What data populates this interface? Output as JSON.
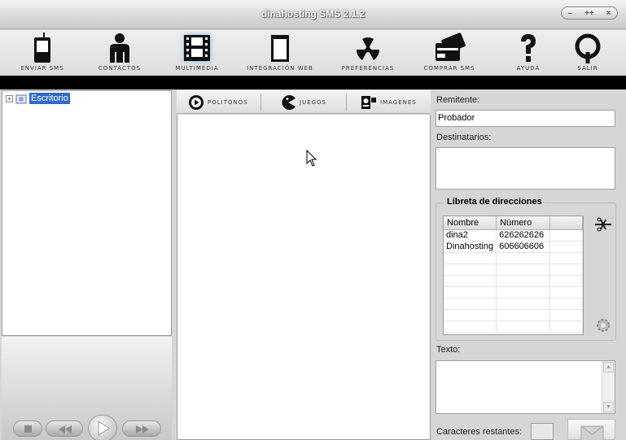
{
  "window": {
    "title": "dinahosting SMS 2.1.2",
    "buttons": [
      "–",
      "++",
      "×"
    ]
  },
  "toolbar": {
    "items": [
      {
        "label": "ENVIAR SMS",
        "icon": "phone-icon"
      },
      {
        "label": "CONTACTOS",
        "icon": "person-icon"
      },
      {
        "label": "MULTIMEDIA",
        "icon": "film-icon"
      },
      {
        "label": "INTEGRACIÓN WEB",
        "icon": "browser-window-icon"
      },
      {
        "label": "PREFERENCIAS",
        "icon": "radiation-icon"
      },
      {
        "label": "COMPRAR SMS",
        "icon": "credit-card-icon"
      },
      {
        "label": "AYUDA",
        "icon": "question-icon"
      },
      {
        "label": "SALIR",
        "icon": "power-icon"
      }
    ]
  },
  "tree": {
    "root_label": "Escritorio",
    "expander": "+"
  },
  "tabs": [
    {
      "label": "POLITONOS",
      "icon": "play-circle-icon"
    },
    {
      "label": "JUEGOS",
      "icon": "pacman-icon"
    },
    {
      "label": "IMAGENES",
      "icon": "camera-icon"
    }
  ],
  "form": {
    "sender_label": "Remitente:",
    "sender_value": "Probador",
    "recipients_label": "Destinatarios:",
    "addressbook_title": "Libreta de direcciones",
    "addressbook_columns": [
      "Nombre",
      "Número"
    ],
    "addressbook_rows": [
      {
        "name": "dina2",
        "number": "626262626"
      },
      {
        "name": "Dinahosting",
        "number": "606606606"
      }
    ],
    "text_label": "Texto:",
    "remaining_label": "Caracteres restantes:"
  },
  "colors": {
    "selection": "#316ac5",
    "toolbar_bar": "#000000",
    "panel_bg": "#d6d6d6"
  }
}
